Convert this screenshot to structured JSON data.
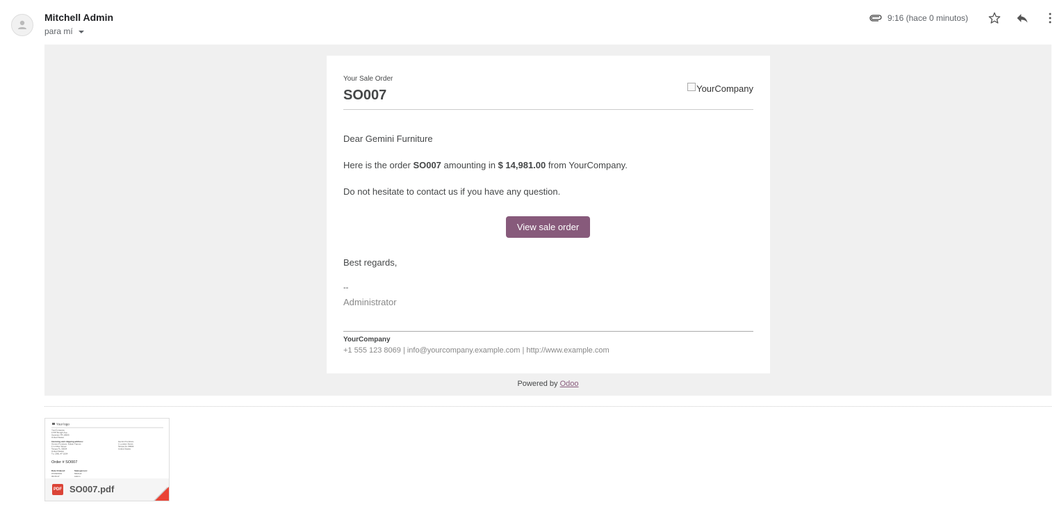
{
  "header": {
    "sender": "Mitchell Admin",
    "recipient": "para mí",
    "time": "9:16 (hace 0 minutos)"
  },
  "email": {
    "pre_title": "Your Sale Order",
    "order_number": "SO007",
    "logo_alt": "YourCompany",
    "greeting": "Dear Gemini Furniture",
    "line_prefix": "Here is the order ",
    "line_order": "SO007",
    "line_mid": " amounting in ",
    "line_amount": "$ 14,981.00",
    "line_suffix": " from YourCompany.",
    "contact_line": "Do not hesitate to contact us if you have any question.",
    "button_label": "View sale order",
    "regards": "Best regards,",
    "sig_dash": "--",
    "sig_name": "Administrator",
    "footer_company": "YourCompany",
    "footer_contact": "+1 555 123 8069 | info@yourcompany.example.com | http://www.example.com"
  },
  "powered": {
    "prefix": "Powered by ",
    "link": "Odoo"
  },
  "attachment": {
    "filename": "SO007.pdf",
    "badge": "PDF",
    "preview": {
      "logo": "Your logo",
      "company_lines": [
        "YourCompany",
        "1725 Slough Ave.",
        "Scranton PA 18505",
        "United States"
      ],
      "invoicing_heading": "Invoicing and shipping address:",
      "invoicing_lines": [
        "Gemini Furniture, Edwin Farmer",
        "1 Lumber Street",
        "Tampa FL 35004",
        "United States",
        "Tu: 2991 #7 1004"
      ],
      "right_lines": [
        "Gemini Furniture",
        "1 Lumber Street",
        "Tampa FL 33604",
        "United States"
      ],
      "order_title": "Order # SO007",
      "col1_head": "Date Ordered:",
      "col1_val": "07/09/2019",
      "col1_val2": "09:06:47",
      "col2_head": "Salesperson:",
      "col2_val": "Mitchell",
      "col2_val2": "Admin"
    }
  },
  "icons": {
    "attachment": "paperclip-icon",
    "star": "star-icon",
    "reply": "reply-icon",
    "more": "more-vert-icon"
  },
  "colors": {
    "brand": "#875A7B",
    "body_bg": "#f0f0f0",
    "pdf": "#db4437"
  }
}
